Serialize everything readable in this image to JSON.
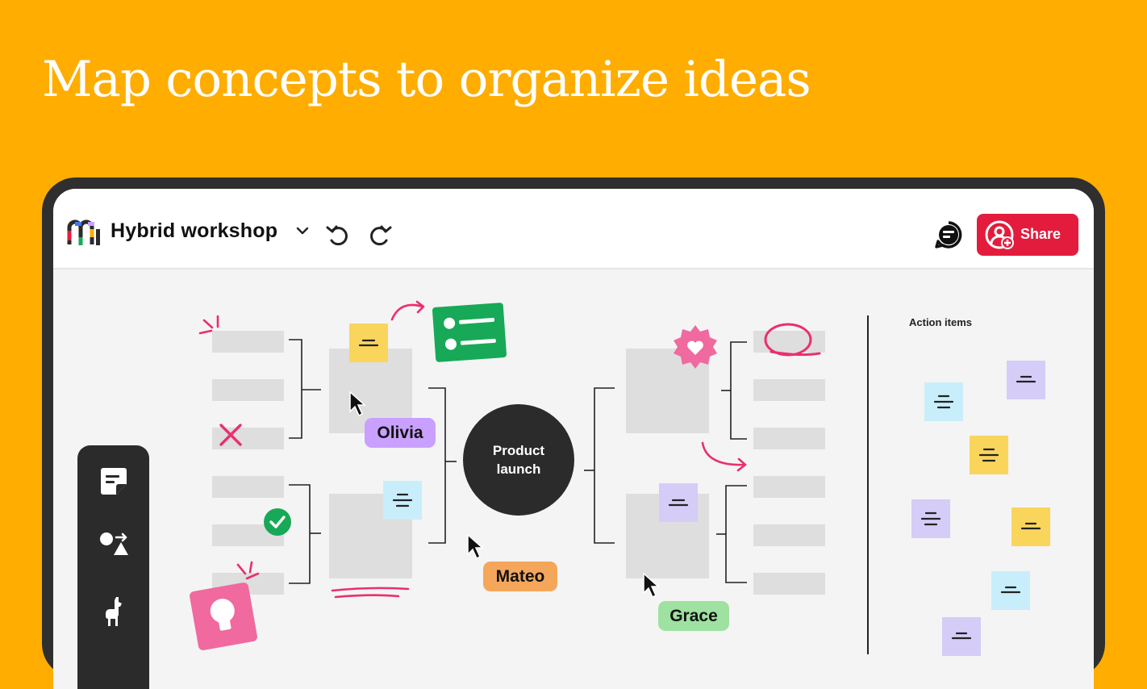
{
  "headline": "Map concepts to organize ideas",
  "app": {
    "board_title": "Hybrid workshop",
    "share_label": "Share"
  },
  "canvas": {
    "hub_line1": "Product",
    "hub_line2": "launch",
    "action_items_title": "Action items",
    "collaborators": [
      {
        "name": "Olivia",
        "color": "#C9A0FF"
      },
      {
        "name": "Mateo",
        "color": "#F4A75A"
      },
      {
        "name": "Grace",
        "color": "#9EE1A0"
      }
    ]
  },
  "icons": {
    "logo": "miro-logo-icon",
    "undo": "undo-icon",
    "redo": "redo-icon",
    "comment": "comment-icon",
    "share": "add-user-icon",
    "tools": [
      "sticky-note-icon",
      "shapes-icon",
      "llama-icon"
    ]
  },
  "colors": {
    "background": "#FFAD00",
    "share_button": "#E31C3D",
    "sticky_yellow": "#FAD55C",
    "sticky_blue": "#C8EEFB",
    "sticky_purple": "#D5CCF7",
    "accent_pink": "#EA2F6E",
    "accent_green": "#17A957"
  }
}
